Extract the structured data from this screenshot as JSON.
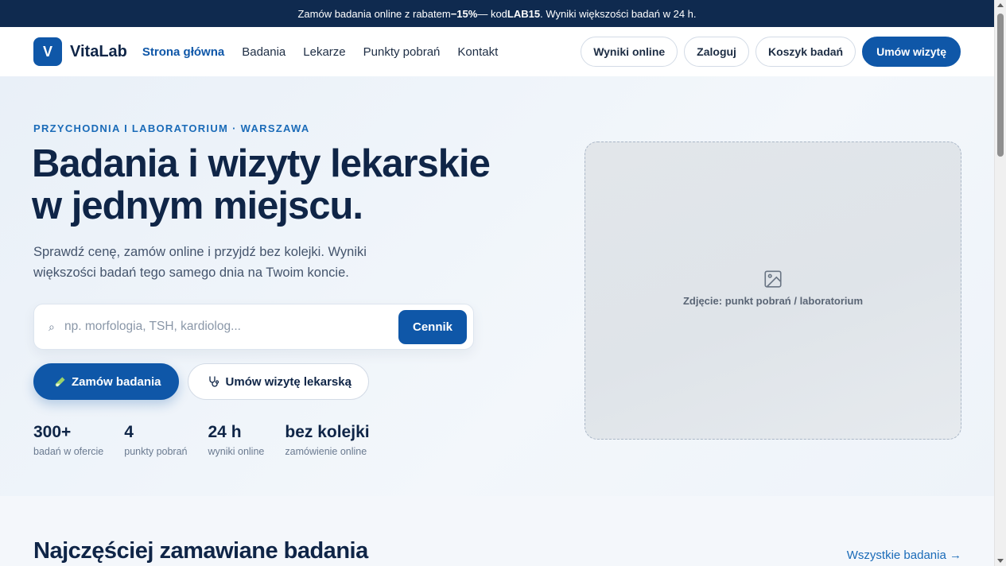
{
  "promo": {
    "prefix": "Zamów badania online z rabatem ",
    "discount": "−15%",
    "middle": " — kod ",
    "code": "LAB15",
    "suffix": ". Wyniki większości badań w 24 h."
  },
  "nav": {
    "logo_letter": "V",
    "brand": "VitaLab",
    "menu": [
      {
        "label": "Strona główna"
      },
      {
        "label": "Badania"
      },
      {
        "label": "Lekarze"
      },
      {
        "label": "Punkty pobrań"
      },
      {
        "label": "Kontakt"
      }
    ],
    "results_label": "Wyniki online",
    "login_label": "Zaloguj",
    "cart_label": "Koszyk badań",
    "book_label": "Umów wizytę"
  },
  "hero": {
    "eyebrow": "PRZYCHODNIA I LABORATORIUM · WARSZAWA",
    "headline_line1": "Badania i wizyty lekarskie",
    "headline_line2": "w jednym miejscu.",
    "lead": "Sprawdź cenę, zamów online i przyjdź bez kolejki. Wyniki większości badań tego samego dnia na Twoim koncie.",
    "search": {
      "icon": "⌕",
      "placeholder": "np. morfologia, TSH, kardiolog...",
      "value": "",
      "button": "Cennik"
    },
    "cta_order": "Zamów badania",
    "cta_visit": "Umów wizytę lekarską",
    "stats": [
      {
        "value": "300+",
        "label": "badań w ofercie"
      },
      {
        "value": "4",
        "label": "punkty pobrań"
      },
      {
        "value": "24 h",
        "label": "wyniki online"
      },
      {
        "value": "bez kolejki",
        "label": "zamówienie online"
      }
    ],
    "photo_caption": "Zdjęcie: punkt pobrań / laboratorium"
  },
  "popular": {
    "title": "Najczęściej zamawiane badania",
    "link": "Wszystkie badania →"
  },
  "colors": {
    "brand": "#0f57a8",
    "promo_bg": "#0f2a4f",
    "heading": "#0f2547",
    "accent_text": "#1a6bb8"
  }
}
